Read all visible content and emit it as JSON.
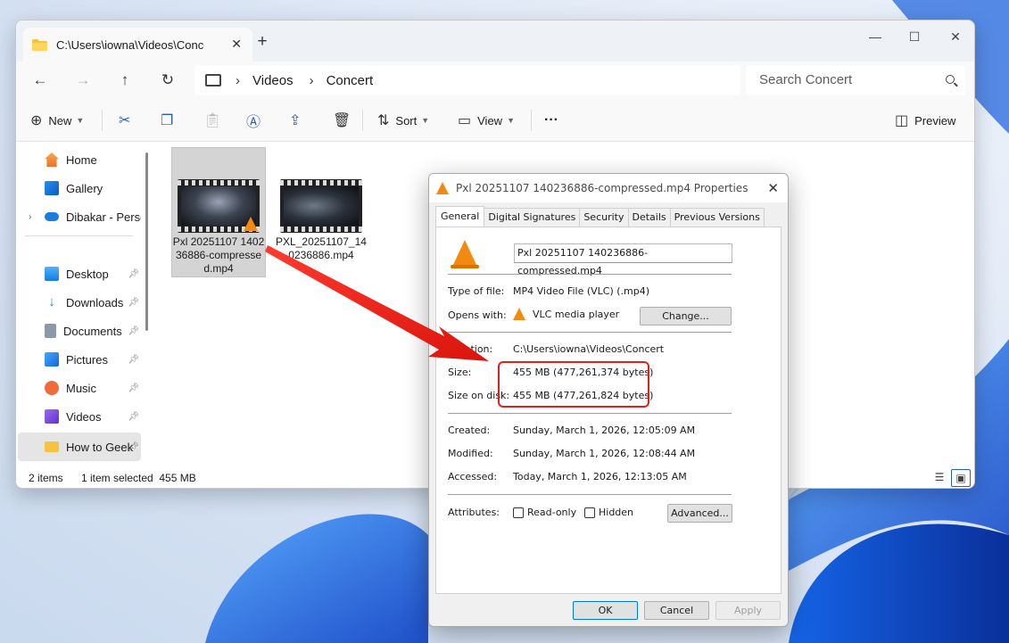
{
  "explorer": {
    "tab_title": "C:\\Users\\iowna\\Videos\\Concert",
    "breadcrumb": [
      "Videos",
      "Concert"
    ],
    "search_placeholder": "Search Concert",
    "toolbar": {
      "new": "New",
      "sort": "Sort",
      "view": "View",
      "preview": "Preview",
      "more": "···"
    },
    "sidebar": {
      "home": "Home",
      "gallery": "Gallery",
      "onedrive": "Dibakar - Personal",
      "desktop": "Desktop",
      "downloads": "Downloads",
      "documents": "Documents",
      "pictures": "Pictures",
      "music": "Music",
      "videos": "Videos",
      "howtogeek": "How to Geek"
    },
    "files": [
      {
        "name": "Pxl 20251107 140236886-compressed.mp4"
      },
      {
        "name": "PXL_20251107_140236886.mp4"
      }
    ],
    "status": {
      "items": "2 items",
      "selected": "1 item selected  455 MB"
    }
  },
  "dialog": {
    "title": "Pxl 20251107 140236886-compressed.mp4 Properties",
    "tabs": [
      "General",
      "Digital Signatures",
      "Security",
      "Details",
      "Previous Versions"
    ],
    "filename": "Pxl 20251107 140236886-compressed.mp4",
    "type_label": "Type of file:",
    "type_value": "MP4 Video File (VLC) (.mp4)",
    "opens_label": "Opens with:",
    "opens_value": "VLC media player",
    "change_button": "Change...",
    "location_label": "Location:",
    "location_value": "C:\\Users\\iowna\\Videos\\Concert",
    "size_label": "Size:",
    "size_value": "455 MB (477,261,374 bytes)",
    "size_disk_label": "Size on disk:",
    "size_disk_value": "455 MB (477,261,824 bytes)",
    "created_label": "Created:",
    "created_value": "Sunday, March 1, 2026, 12:05:09 AM",
    "modified_label": "Modified:",
    "modified_value": "Sunday, March 1, 2026, 12:08:44 AM",
    "accessed_label": "Accessed:",
    "accessed_value": "Today, March 1, 2026, 12:13:05 AM",
    "attributes_label": "Attributes:",
    "readonly": "Read-only",
    "hidden": "Hidden",
    "advanced_button": "Advanced...",
    "ok": "OK",
    "cancel": "Cancel",
    "apply": "Apply"
  },
  "colors": {
    "accent": "#2a5fa8",
    "annotation": "#e0201a",
    "vlc_orange": "#f28a12"
  }
}
